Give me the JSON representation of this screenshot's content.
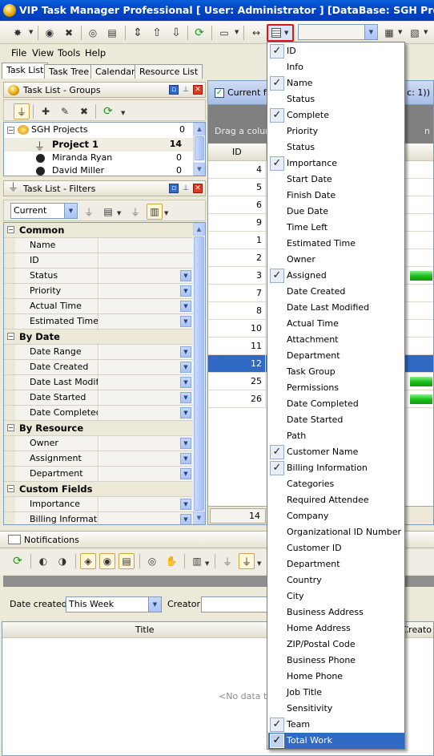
{
  "window": {
    "title": "VIP Task Manager Professional [ User: Administrator ] [DataBase: SGH Projects]"
  },
  "menubar": {
    "file": "File",
    "view": "View",
    "tools": "Tools",
    "help": "Help"
  },
  "tabs": [
    {
      "label": "Task List",
      "active": true
    },
    {
      "label": "Task Tree",
      "active": false
    },
    {
      "label": "Calendar",
      "active": false
    },
    {
      "label": "Resource List",
      "active": false
    }
  ],
  "groups_panel": {
    "title": "Task List - Groups",
    "items": [
      {
        "label": "SGH Projects",
        "count": "0",
        "bold": false
      },
      {
        "label": "Project 1",
        "count": "14",
        "bold": true
      },
      {
        "label": "Miranda Ryan",
        "count": "0",
        "bold": false
      },
      {
        "label": "David Miller",
        "count": "0",
        "bold": false
      }
    ]
  },
  "filters_panel": {
    "title": "Task List - Filters",
    "preset": "Current",
    "categories": [
      {
        "name": "Common",
        "fields": [
          {
            "label": "Name",
            "dropdown": false
          },
          {
            "label": "ID",
            "dropdown": false
          },
          {
            "label": "Status",
            "dropdown": true
          },
          {
            "label": "Priority",
            "dropdown": true
          },
          {
            "label": "Actual Time",
            "dropdown": true
          },
          {
            "label": "Estimated Time",
            "dropdown": true
          }
        ]
      },
      {
        "name": "By Date",
        "fields": [
          {
            "label": "Date Range",
            "dropdown": true
          },
          {
            "label": "Date Created",
            "dropdown": true
          },
          {
            "label": "Date Last Modifi",
            "dropdown": true
          },
          {
            "label": "Date Started",
            "dropdown": true
          },
          {
            "label": "Date Completed",
            "dropdown": true
          }
        ]
      },
      {
        "name": "By Resource",
        "fields": [
          {
            "label": "Owner",
            "dropdown": true
          },
          {
            "label": "Assignment",
            "dropdown": true
          },
          {
            "label": "Department",
            "dropdown": true
          }
        ]
      },
      {
        "name": "Custom Fields",
        "fields": [
          {
            "label": "Importance",
            "dropdown": true
          },
          {
            "label": "Billing Informatio",
            "dropdown": true
          }
        ]
      }
    ]
  },
  "main_grid": {
    "filter_label": "Current filt",
    "filter_suffix": "c: 1))",
    "group_hint": "Drag a column",
    "group_hint_suffix": "n",
    "id_header": "ID",
    "rows": [
      {
        "id": "4",
        "progress": false,
        "selected": false
      },
      {
        "id": "5",
        "progress": false,
        "selected": false
      },
      {
        "id": "6",
        "progress": false,
        "selected": false
      },
      {
        "id": "9",
        "progress": false,
        "selected": false
      },
      {
        "id": "1",
        "progress": false,
        "selected": false
      },
      {
        "id": "2",
        "progress": false,
        "selected": false
      },
      {
        "id": "3",
        "progress": true,
        "selected": false
      },
      {
        "id": "7",
        "progress": false,
        "selected": false
      },
      {
        "id": "8",
        "progress": false,
        "selected": false
      },
      {
        "id": "10",
        "progress": false,
        "selected": false
      },
      {
        "id": "11",
        "progress": false,
        "selected": false
      },
      {
        "id": "12",
        "progress": false,
        "selected": true
      },
      {
        "id": "25",
        "progress": true,
        "selected": false
      },
      {
        "id": "26",
        "progress": true,
        "selected": false
      }
    ],
    "footer_count": "14"
  },
  "notifications": {
    "title": "Notifications",
    "date_created_label": "Date created:",
    "date_created_value": "This Week",
    "creator_label": "Creator:",
    "col_title": "Title",
    "col_creator": "Creato",
    "empty_text": "<No data to d"
  },
  "column_menu": {
    "items": [
      {
        "label": "ID",
        "checked": true,
        "highlighted": false
      },
      {
        "label": "Info",
        "checked": false,
        "highlighted": false
      },
      {
        "label": "Name",
        "checked": true,
        "highlighted": false
      },
      {
        "label": "Status",
        "checked": false,
        "highlighted": false
      },
      {
        "label": "Complete",
        "checked": true,
        "highlighted": false
      },
      {
        "label": "Priority",
        "checked": false,
        "highlighted": false
      },
      {
        "label": "Status",
        "checked": false,
        "highlighted": false
      },
      {
        "label": "Importance",
        "checked": true,
        "highlighted": false
      },
      {
        "label": "Start Date",
        "checked": false,
        "highlighted": false
      },
      {
        "label": "Finish Date",
        "checked": false,
        "highlighted": false
      },
      {
        "label": "Due Date",
        "checked": false,
        "highlighted": false
      },
      {
        "label": "Time Left",
        "checked": false,
        "highlighted": false
      },
      {
        "label": "Estimated Time",
        "checked": false,
        "highlighted": false
      },
      {
        "label": "Owner",
        "checked": false,
        "highlighted": false
      },
      {
        "label": "Assigned",
        "checked": true,
        "highlighted": false
      },
      {
        "label": "Date Created",
        "checked": false,
        "highlighted": false
      },
      {
        "label": "Date Last Modified",
        "checked": false,
        "highlighted": false
      },
      {
        "label": "Actual Time",
        "checked": false,
        "highlighted": false
      },
      {
        "label": "Attachment",
        "checked": false,
        "highlighted": false
      },
      {
        "label": "Department",
        "checked": false,
        "highlighted": false
      },
      {
        "label": "Task Group",
        "checked": false,
        "highlighted": false
      },
      {
        "label": "Permissions",
        "checked": false,
        "highlighted": false
      },
      {
        "label": "Date Completed",
        "checked": false,
        "highlighted": false
      },
      {
        "label": "Date Started",
        "checked": false,
        "highlighted": false
      },
      {
        "label": "Path",
        "checked": false,
        "highlighted": false
      },
      {
        "label": "Customer Name",
        "checked": true,
        "highlighted": false
      },
      {
        "label": "Billing Information",
        "checked": true,
        "highlighted": false
      },
      {
        "label": "Categories",
        "checked": false,
        "highlighted": false
      },
      {
        "label": "Required Attendee",
        "checked": false,
        "highlighted": false
      },
      {
        "label": "Company",
        "checked": false,
        "highlighted": false
      },
      {
        "label": "Organizational ID Number",
        "checked": false,
        "highlighted": false
      },
      {
        "label": "Customer ID",
        "checked": false,
        "highlighted": false
      },
      {
        "label": "Department",
        "checked": false,
        "highlighted": false
      },
      {
        "label": "Country",
        "checked": false,
        "highlighted": false
      },
      {
        "label": "City",
        "checked": false,
        "highlighted": false
      },
      {
        "label": "Business Address",
        "checked": false,
        "highlighted": false
      },
      {
        "label": "Home Address",
        "checked": false,
        "highlighted": false
      },
      {
        "label": "ZIP/Postal Code",
        "checked": false,
        "highlighted": false
      },
      {
        "label": "Business Phone",
        "checked": false,
        "highlighted": false
      },
      {
        "label": "Home Phone",
        "checked": false,
        "highlighted": false
      },
      {
        "label": "Job Title",
        "checked": false,
        "highlighted": false
      },
      {
        "label": "Sensitivity",
        "checked": false,
        "highlighted": false
      },
      {
        "label": "Team",
        "checked": true,
        "highlighted": false
      },
      {
        "label": "Total Work",
        "checked": true,
        "highlighted": true
      }
    ]
  },
  "icons": {
    "check": "check-icon",
    "app": "app-icon",
    "filter": "filter-icon",
    "refresh": "refresh-icon",
    "columns": "column-chooser-icon",
    "pin": "pin-icon",
    "close": "close-icon"
  },
  "colors": {
    "titlebar": "#0046c8",
    "selection": "#316ac5",
    "highlight_border": "#e0141b",
    "progress_green": "#1bc21b",
    "group_panel": "#808080"
  }
}
